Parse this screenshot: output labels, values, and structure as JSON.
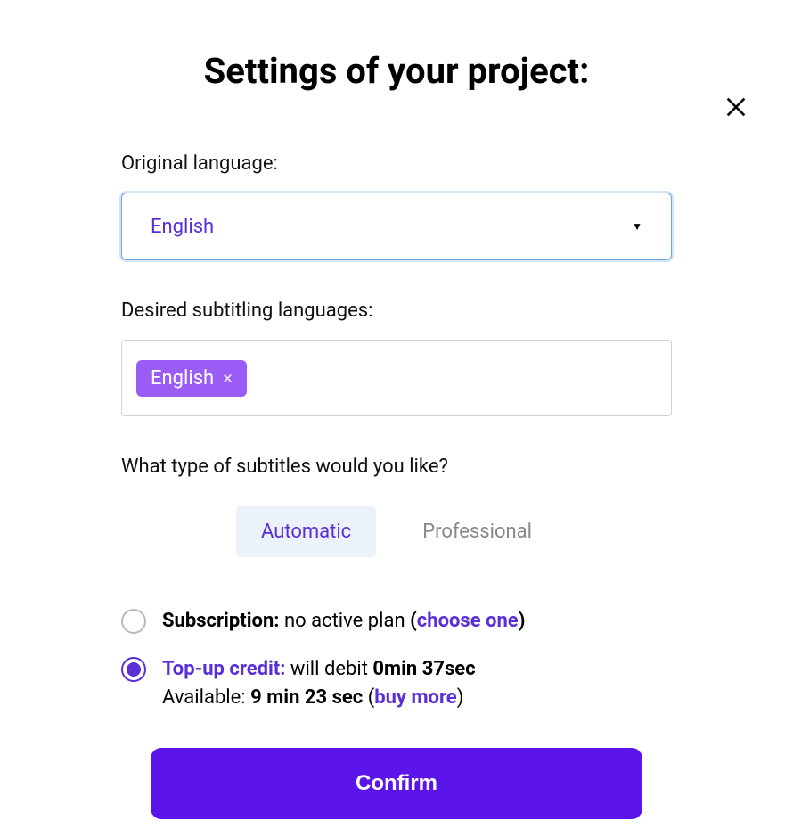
{
  "modal": {
    "title": "Settings of your project:",
    "close_label": "Close"
  },
  "originalLanguage": {
    "label": "Original language:",
    "selected": "English"
  },
  "desiredLanguages": {
    "label": "Desired subtitling languages:",
    "tags": [
      {
        "label": "English"
      }
    ]
  },
  "subtitleType": {
    "question": "What type of subtitles would you like?",
    "tabs": {
      "automatic": "Automatic",
      "professional": "Professional"
    },
    "active": "automatic"
  },
  "plans": {
    "subscription": {
      "label": "Subscription:",
      "status": "no active plan",
      "choose": "choose one"
    },
    "topup": {
      "label": "Top-up credit:",
      "debit_prefix": "will debit",
      "debit_amount": "0min 37sec",
      "available_prefix": "Available:",
      "available_amount": "9 min 23 sec",
      "buy_more": "buy more"
    }
  },
  "confirm": {
    "label": "Confirm"
  }
}
